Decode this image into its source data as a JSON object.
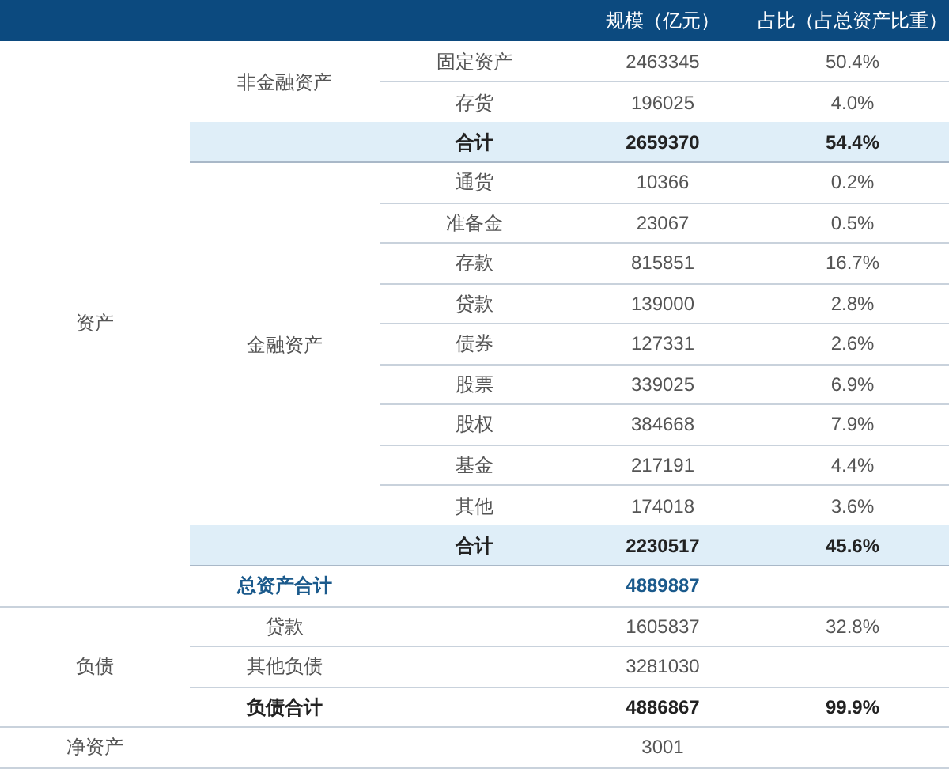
{
  "header": {
    "scale": "规模（亿元）",
    "share": "占比（占总资产比重）"
  },
  "assets": {
    "label": "资产",
    "groups": [
      {
        "label": "非金融资产",
        "items": [
          {
            "name": "固定资产",
            "value": "2463345",
            "share": "50.4%"
          },
          {
            "name": "存货",
            "value": "196025",
            "share": "4.0%"
          }
        ],
        "total": {
          "label": "合计",
          "value": "2659370",
          "share": "54.4%"
        }
      },
      {
        "label": "金融资产",
        "items": [
          {
            "name": "通货",
            "value": "10366",
            "share": "0.2%"
          },
          {
            "name": "准备金",
            "value": "23067",
            "share": "0.5%"
          },
          {
            "name": "存款",
            "value": "815851",
            "share": "16.7%"
          },
          {
            "name": "贷款",
            "value": "139000",
            "share": "2.8%"
          },
          {
            "name": "债券",
            "value": "127331",
            "share": "2.6%"
          },
          {
            "name": "股票",
            "value": "339025",
            "share": "6.9%"
          },
          {
            "name": "股权",
            "value": "384668",
            "share": "7.9%"
          },
          {
            "name": "基金",
            "value": "217191",
            "share": "4.4%"
          },
          {
            "name": "其他",
            "value": "174018",
            "share": "3.6%"
          }
        ],
        "total": {
          "label": "合计",
          "value": "2230517",
          "share": "45.6%"
        }
      }
    ],
    "total": {
      "label": "总资产合计",
      "value": "4889887"
    }
  },
  "liabilities": {
    "label": "负债",
    "items": [
      {
        "name": "贷款",
        "value": "1605837",
        "share": "32.8%"
      },
      {
        "name": "其他负债",
        "value": "3281030"
      }
    ],
    "total": {
      "label": "负债合计",
      "value": "4886867",
      "share": "99.9%"
    }
  },
  "net_assets": {
    "label": "净资产",
    "value": "3001"
  }
}
